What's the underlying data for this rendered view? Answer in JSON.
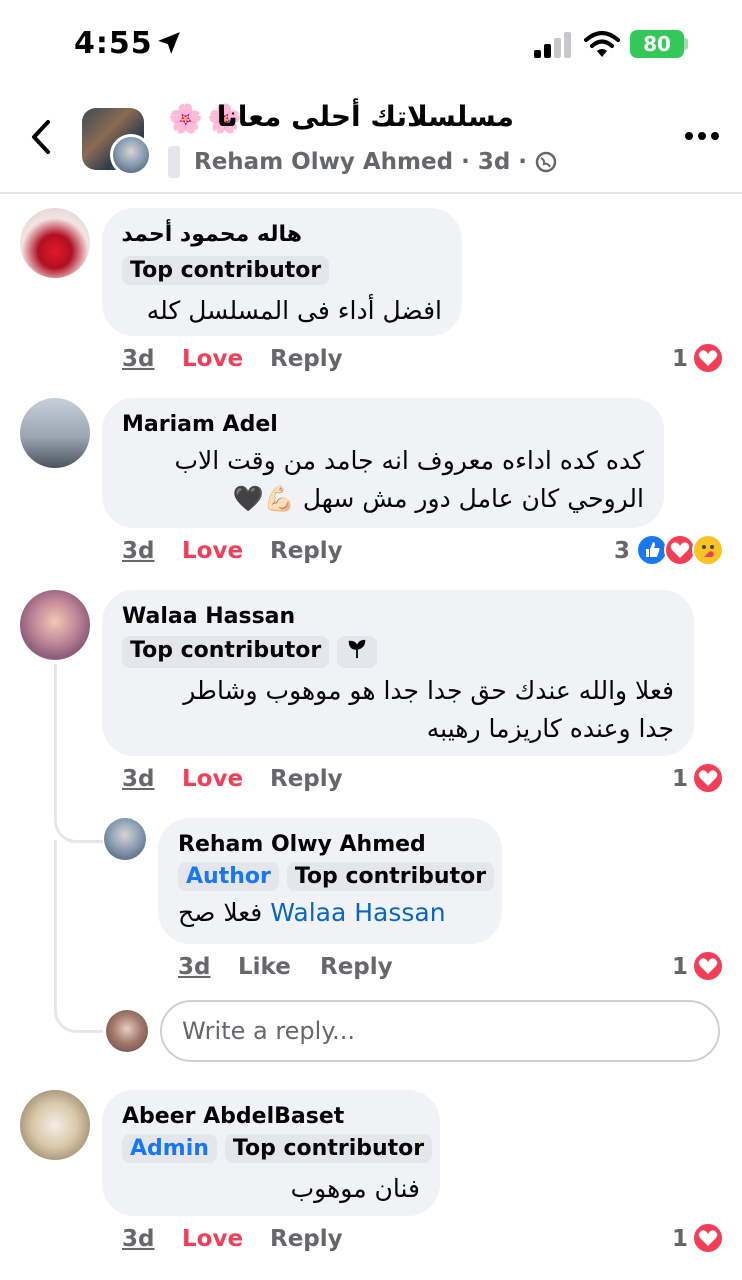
{
  "status_bar": {
    "time": "4:55",
    "battery": "80"
  },
  "header": {
    "group_title": "مسلسلاتك أحلى معانا",
    "author": "Reham Olwy Ahmed",
    "sep1": "·",
    "age": "3d",
    "sep2": "·"
  },
  "comments": [
    {
      "name": "هاله محمود أحمد",
      "badges": [
        "Top contributor"
      ],
      "text_lines": [
        "افضل أداء فى المسلسل كله"
      ],
      "time": "3d",
      "react_label": "Love",
      "reply_label": "Reply",
      "reaction_count": "1"
    },
    {
      "name": "Mariam Adel",
      "badges": [],
      "text_lines": [
        "كده كده اداءه معروف انه جامد من وقت الاب",
        "الروحي كان عامل دور مش سهل 💪🏻🖤"
      ],
      "time": "3d",
      "react_label": "Love",
      "reply_label": "Reply",
      "reaction_count": "3"
    },
    {
      "name": "Walaa Hassan",
      "badges": [
        "Top contributor"
      ],
      "text_lines": [
        "فعلا والله عندك حق جدا جدا هو موهوب وشاطر",
        "جدا وعنده كاريزما رهيبه"
      ],
      "time": "3d",
      "react_label": "Love",
      "reply_label": "Reply",
      "reaction_count": "1"
    },
    {
      "name": "Abeer AbdelBaset",
      "badges": [
        "Admin",
        "Top contributor"
      ],
      "text_lines": [
        "فنان موهوب"
      ],
      "time": "3d",
      "react_label": "Love",
      "reply_label": "Reply",
      "reaction_count": "1"
    }
  ],
  "reply": {
    "name": "Reham Olwy Ahmed",
    "badges": [
      "Author",
      "Top contributor"
    ],
    "mention": "Walaa Hassan",
    "text": "فعلا صح",
    "time": "3d",
    "react_label": "Like",
    "reply_label": "Reply",
    "reaction_count": "1"
  },
  "reply_input": {
    "placeholder": "Write a reply..."
  },
  "colors": {
    "love": "#f33e58",
    "like_blue": "#1877f2",
    "muted": "#65676b",
    "bubble": "#f0f2f5"
  }
}
